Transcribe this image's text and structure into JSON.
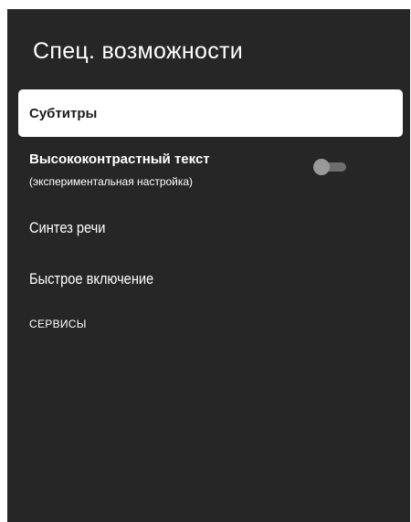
{
  "page": {
    "title": "Спец. возможности"
  },
  "menu": {
    "subtitles_label": "Субтитры",
    "high_contrast_label": "Высококонтрастный текст",
    "high_contrast_sub": "(экспериментальная настройка)",
    "high_contrast_enabled": false,
    "tts_label": "Синтез речи",
    "quick_enable_label": "Быстрое включение"
  },
  "services": {
    "header": "СЕРВИСЫ"
  },
  "colors": {
    "background": "#262626",
    "highlight": "#ffffff",
    "toggle_off": "#6e6e6e"
  }
}
